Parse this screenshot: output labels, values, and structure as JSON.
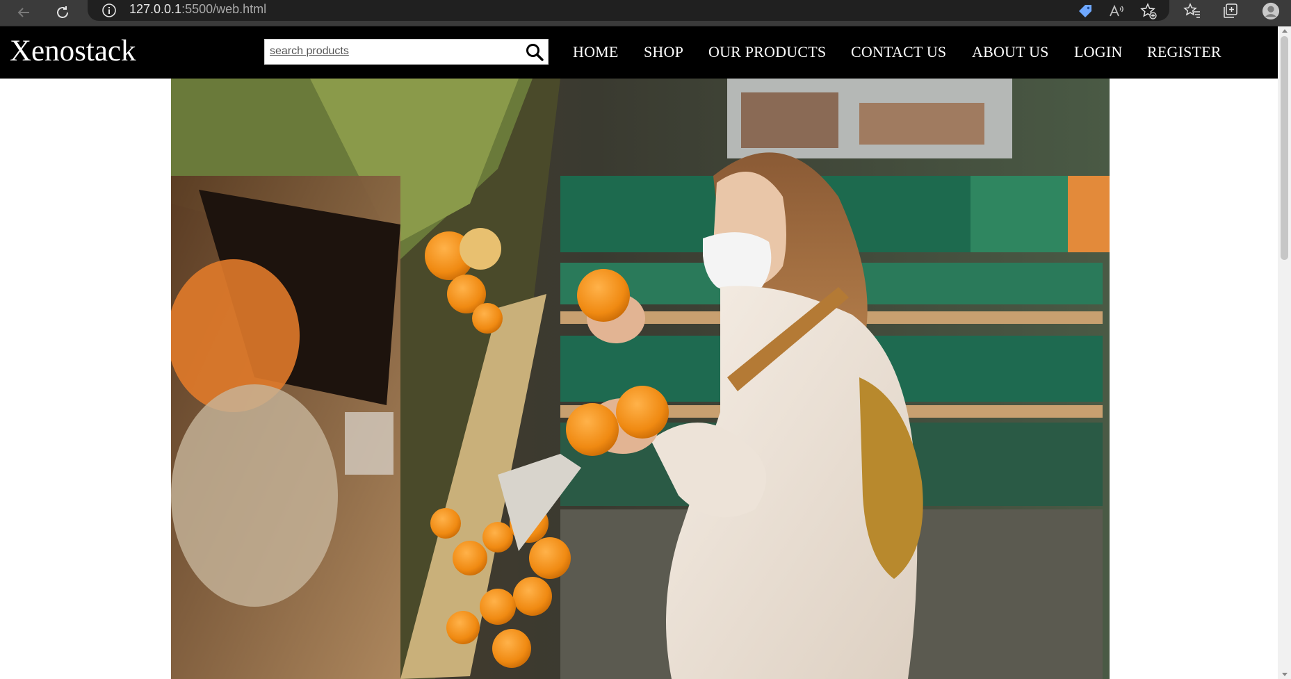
{
  "browser": {
    "url_host": "127.0.0.1",
    "url_rest": ":5500/web.html"
  },
  "site": {
    "logo": "Xenostack",
    "search": {
      "placeholder": "search products"
    },
    "nav": [
      {
        "label": "HOME"
      },
      {
        "label": "SHOP"
      },
      {
        "label": "OUR PRODUCTS"
      },
      {
        "label": "CONTACT US"
      },
      {
        "label": "ABOUT US"
      },
      {
        "label": "LOGIN"
      },
      {
        "label": "REGISTER"
      }
    ]
  },
  "icons": {
    "back": "back-arrow-icon",
    "refresh": "refresh-icon",
    "info": "info-icon",
    "tag": "tag-icon",
    "read_aloud": "read-aloud-icon",
    "add_favorite": "add-favorite-icon",
    "favorites": "favorites-icon",
    "collections": "collections-icon",
    "profile": "profile-icon",
    "search": "search-icon"
  },
  "colors": {
    "header_bg": "#000000",
    "header_text": "#ffffff",
    "browser_bg": "#3b3b3b",
    "tag_icon": "#6fa8ff"
  }
}
